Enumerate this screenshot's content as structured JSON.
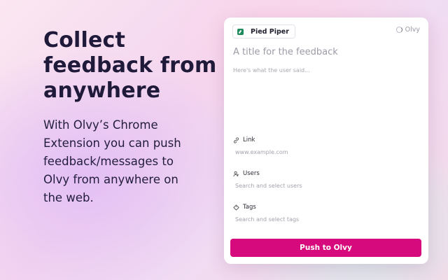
{
  "hero": {
    "headline_lines": [
      "Collect",
      "feedback from",
      "anywhere"
    ],
    "blurb": "With Olvy’s Chrome Extension you can push feedback/messages to Olvy from anywhere on the web."
  },
  "card": {
    "workspace": "Pied Piper",
    "brand": "Olvy",
    "title_placeholder": "A title for the feedback",
    "body_placeholder": "Here's what the user said...",
    "link": {
      "label": "Link",
      "placeholder": "www.example.com"
    },
    "users": {
      "label": "Users",
      "placeholder": "Search and select users"
    },
    "tags": {
      "label": "Tags",
      "placeholder": "Search and select tags"
    },
    "submit_label": "Push to Olvy"
  },
  "colors": {
    "accent": "#d60a7c",
    "headline": "#1f1a3a",
    "workspace_logo": "#1f8a5b"
  },
  "icons": [
    "link-icon",
    "users-icon",
    "tag-icon",
    "olvy-logo-icon",
    "pied-piper-logo-icon"
  ]
}
